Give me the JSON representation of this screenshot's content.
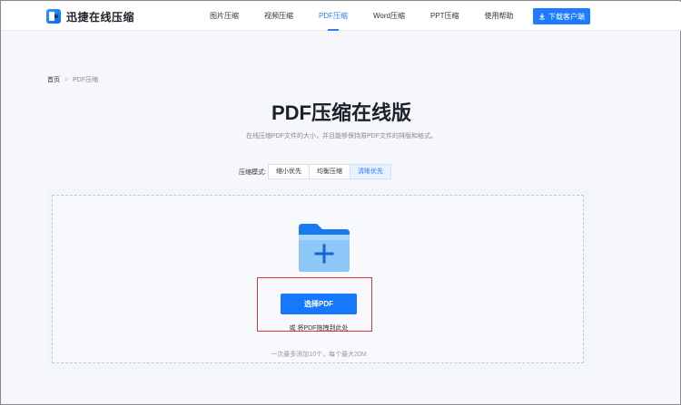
{
  "header": {
    "logo_text": "迅捷在线压缩",
    "nav": [
      {
        "label": "图片压缩",
        "active": false
      },
      {
        "label": "视频压缩",
        "active": false
      },
      {
        "label": "PDF压缩",
        "active": true
      },
      {
        "label": "Word压缩",
        "active": false
      },
      {
        "label": "PPT压缩",
        "active": false
      },
      {
        "label": "使用帮助",
        "active": false
      }
    ],
    "download_label": "下载客户端"
  },
  "breadcrumb": {
    "home": "首页",
    "separator": ">",
    "current": "PDF压缩"
  },
  "main": {
    "title": "PDF压缩在线版",
    "description": "在线压缩PDF文件的大小，并且能够保持原PDF文件的排版和格式。",
    "modes_label": "压缩模式:",
    "modes": [
      {
        "label": "缩小优先",
        "active": false
      },
      {
        "label": "均衡压缩",
        "active": false
      },
      {
        "label": "清晰优先",
        "active": true
      }
    ]
  },
  "upload": {
    "select_label": "选择PDF",
    "drag_hint": "或 将PDF拖拽到此处",
    "limit_note": "一次最多添加10个，每个最大20M"
  },
  "colors": {
    "accent": "#1677ff",
    "highlight": "#e0353b"
  }
}
